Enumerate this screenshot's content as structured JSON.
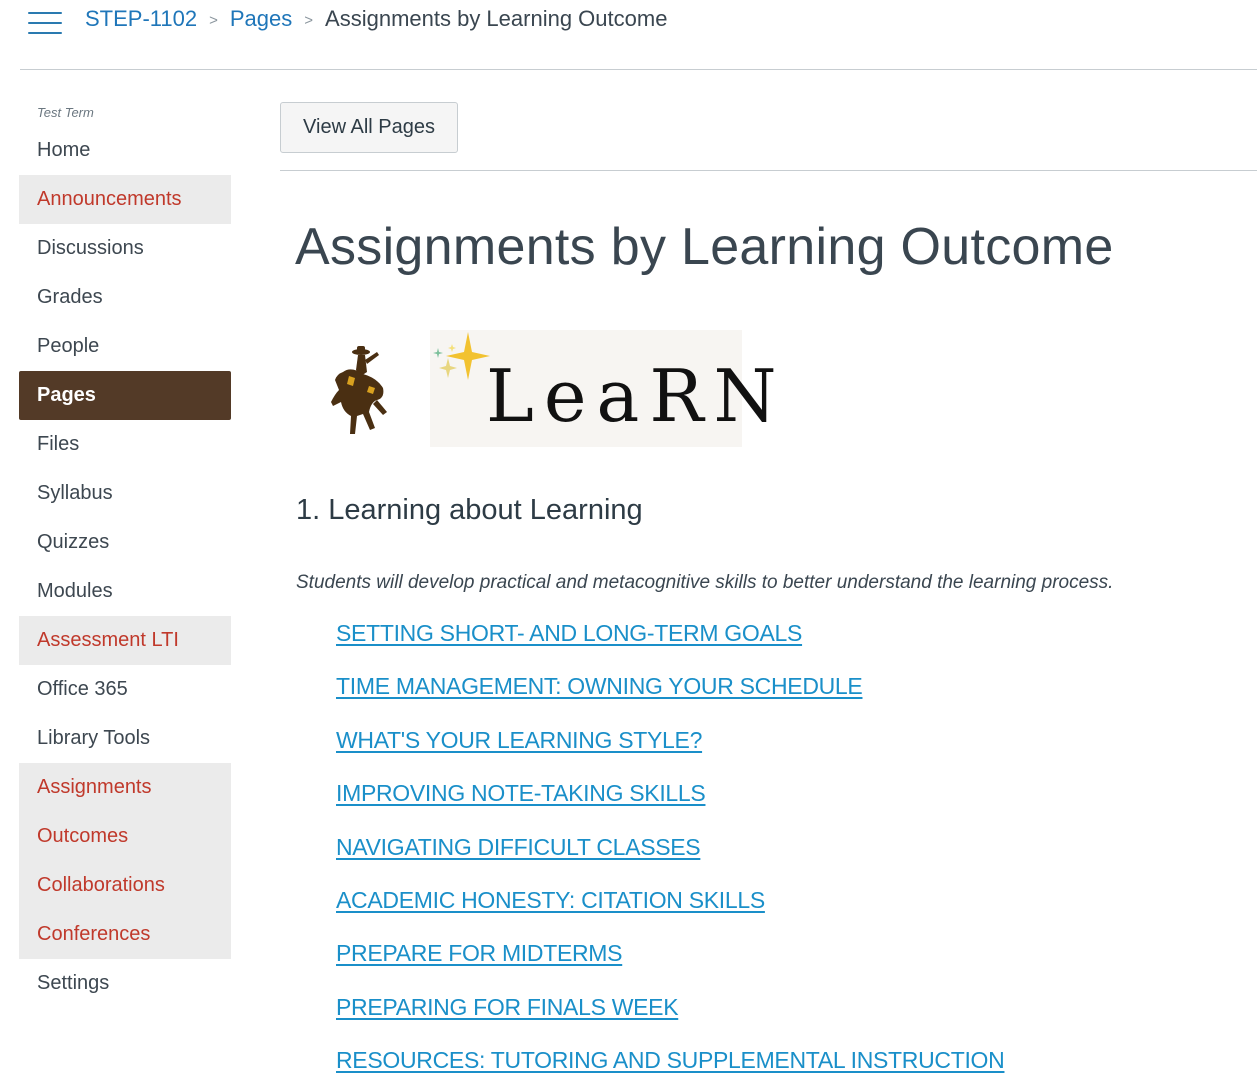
{
  "breadcrumb": {
    "course": "STEP-1102",
    "section": "Pages",
    "current": "Assignments by Learning Outcome",
    "separator": ">"
  },
  "sidebar": {
    "term": "Test Term",
    "items": [
      {
        "label": "Home",
        "state": "normal"
      },
      {
        "label": "Announcements",
        "state": "hidden"
      },
      {
        "label": "Discussions",
        "state": "normal"
      },
      {
        "label": "Grades",
        "state": "normal"
      },
      {
        "label": "People",
        "state": "normal"
      },
      {
        "label": "Pages",
        "state": "active"
      },
      {
        "label": "Files",
        "state": "normal"
      },
      {
        "label": "Syllabus",
        "state": "normal"
      },
      {
        "label": "Quizzes",
        "state": "normal"
      },
      {
        "label": "Modules",
        "state": "normal"
      },
      {
        "label": "Assessment LTI",
        "state": "hidden"
      },
      {
        "label": "Office 365",
        "state": "normal"
      },
      {
        "label": "Library Tools",
        "state": "normal"
      },
      {
        "label": "Assignments",
        "state": "hidden"
      },
      {
        "label": "Outcomes",
        "state": "hidden"
      },
      {
        "label": "Collaborations",
        "state": "hidden"
      },
      {
        "label": "Conferences",
        "state": "hidden"
      },
      {
        "label": "Settings",
        "state": "normal"
      }
    ]
  },
  "toolbar": {
    "view_all_label": "View All Pages"
  },
  "page": {
    "title": "Assignments by Learning Outcome",
    "logo_text": "LeaRN",
    "section": {
      "heading": "1. Learning about Learning",
      "description": "Students will develop practical and metacognitive skills to better understand the learning process.",
      "links": [
        "SETTING SHORT- AND LONG-TERM GOALS",
        "TIME MANAGEMENT: OWNING YOUR SCHEDULE",
        "WHAT'S YOUR LEARNING STYLE?",
        "IMPROVING NOTE-TAKING SKILLS",
        "NAVIGATING DIFFICULT CLASSES",
        "ACADEMIC HONESTY: CITATION SKILLS",
        "PREPARE FOR MIDTERMS",
        "PREPARING FOR FINALS WEEK",
        "RESOURCES: TUTORING AND SUPPLEMENTAL INSTRUCTION"
      ]
    }
  },
  "colors": {
    "link": "#1a8fc9",
    "breadcrumb_link": "#1f76b9",
    "active_nav_bg": "#533a27",
    "hidden_nav_text": "#c0392b",
    "hidden_nav_bg": "#ebebeb",
    "logo_gold": "#f2c230",
    "logo_brown": "#4a2f12"
  },
  "icons": {
    "menu": "hamburger-icon",
    "crumb_separator": "chevron-right-icon",
    "mascot": "bucking-horse-logo",
    "sparkle": "sparkle-icon"
  }
}
